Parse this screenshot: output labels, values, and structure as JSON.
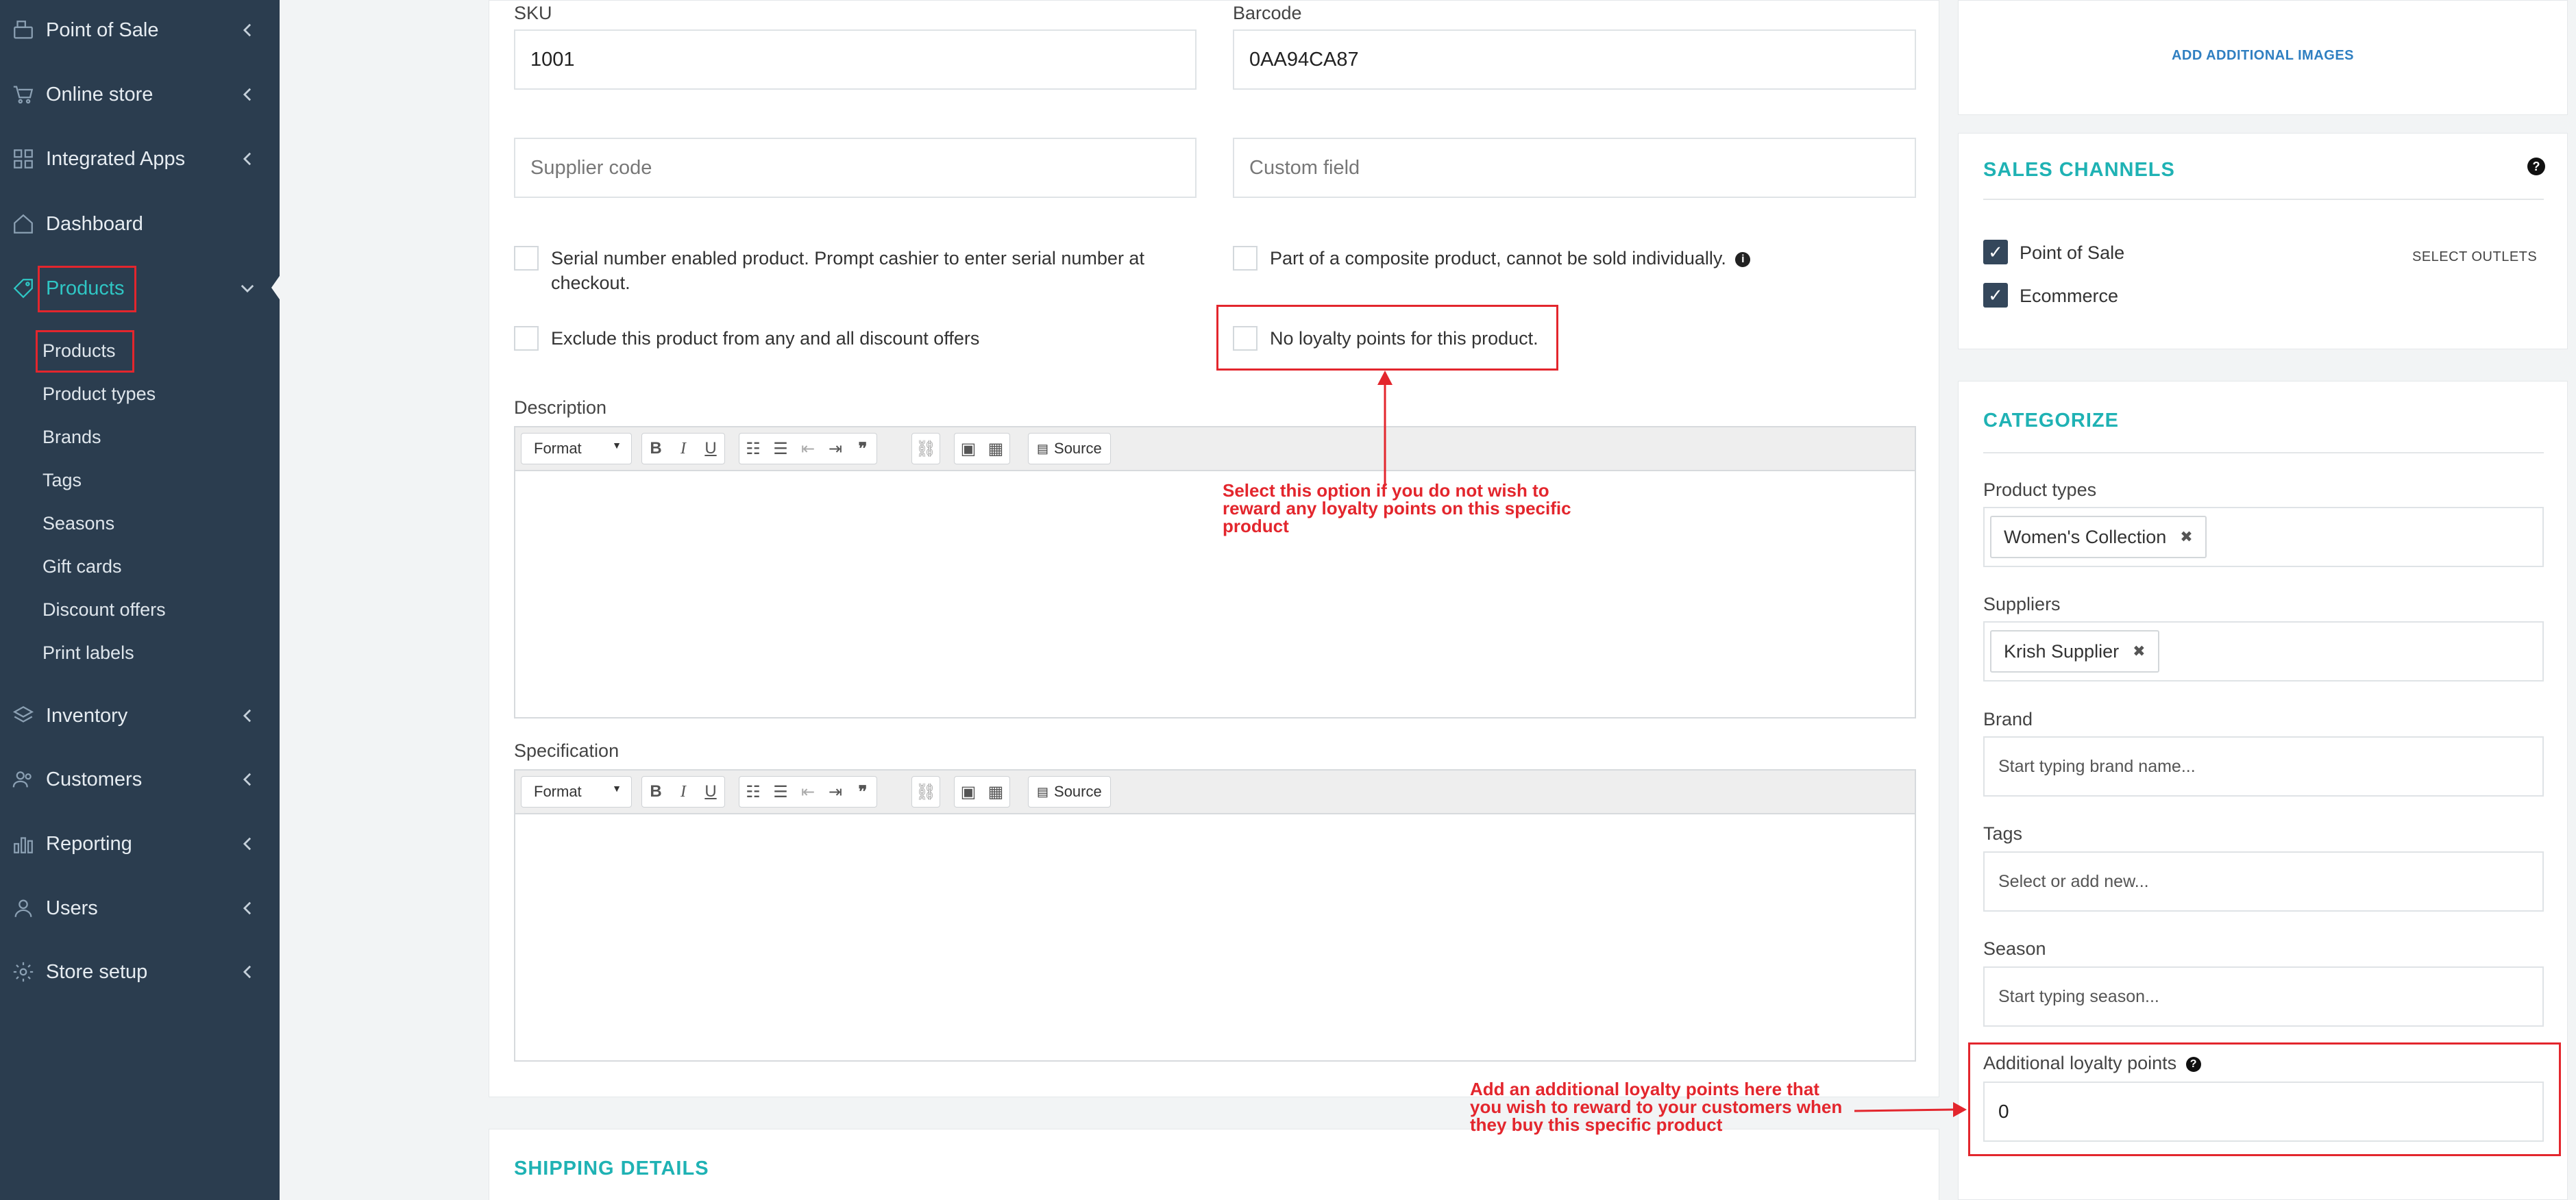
{
  "sidebar": {
    "items": [
      {
        "label": "Point of Sale",
        "icon": "cash-register-icon"
      },
      {
        "label": "Online store",
        "icon": "cart-icon"
      },
      {
        "label": "Integrated Apps",
        "icon": "grid-icon"
      },
      {
        "label": "Dashboard",
        "icon": "home-icon"
      },
      {
        "label": "Products",
        "icon": "tag-icon"
      },
      {
        "label": "Inventory",
        "icon": "layers-icon"
      },
      {
        "label": "Customers",
        "icon": "people-icon"
      },
      {
        "label": "Reporting",
        "icon": "bar-chart-icon"
      },
      {
        "label": "Users",
        "icon": "user-icon"
      },
      {
        "label": "Store setup",
        "icon": "gear-icon"
      }
    ],
    "sub_items": [
      "Products",
      "Product types",
      "Brands",
      "Tags",
      "Seasons",
      "Gift cards",
      "Discount offers",
      "Print labels"
    ]
  },
  "form": {
    "sku_label": "SKU",
    "sku_value": "1001",
    "barcode_label": "Barcode",
    "barcode_value": "0AA94CA87",
    "supplier_code_placeholder": "Supplier code",
    "custom_field_placeholder": "Custom field",
    "serial_label_line1": "Serial number enabled product. Prompt cashier to enter serial number at",
    "serial_label_line2": "checkout.",
    "composite_label": "Part of a composite product, cannot be sold individually.",
    "exclude_discount_label": "Exclude this product from any and all discount offers",
    "no_loyalty_label": "No loyalty points for this product.",
    "description_label": "Description",
    "specification_label": "Specification",
    "editor": {
      "format_label": "Format",
      "source_label": "Source"
    }
  },
  "shipping": {
    "title": "SHIPPING DETAILS"
  },
  "right": {
    "add_images_label": "ADD ADDITIONAL IMAGES",
    "sales_channels_title": "SALES CHANNELS",
    "channels": [
      {
        "label": "Point of Sale",
        "checked": true
      },
      {
        "label": "Ecommerce",
        "checked": true
      }
    ],
    "select_outlets_label": "SELECT OUTLETS",
    "categorize_title": "CATEGORIZE",
    "product_types_label": "Product types",
    "product_type_tag": "Women's Collection",
    "suppliers_label": "Suppliers",
    "supplier_tag": "Krish Supplier",
    "brand_label": "Brand",
    "brand_placeholder": "Start typing brand name...",
    "tags_label": "Tags",
    "tags_placeholder": "Select or add new...",
    "season_label": "Season",
    "season_placeholder": "Start typing season...",
    "loyalty_label": "Additional loyalty points",
    "loyalty_value": "0"
  },
  "annotations": {
    "no_loyalty_note_1": "Select this option if you do not wish to",
    "no_loyalty_note_2": "reward any loyalty points on this specific",
    "no_loyalty_note_3": "product",
    "additional_note_1": "Add an additional loyalty points here that",
    "additional_note_2": "you wish to reward to your customers when",
    "additional_note_3": "they buy this specific product"
  },
  "colors": {
    "sidebar_bg": "#2b3d4f",
    "accent": "#1fb2b4",
    "annotation": "#e3262d"
  }
}
